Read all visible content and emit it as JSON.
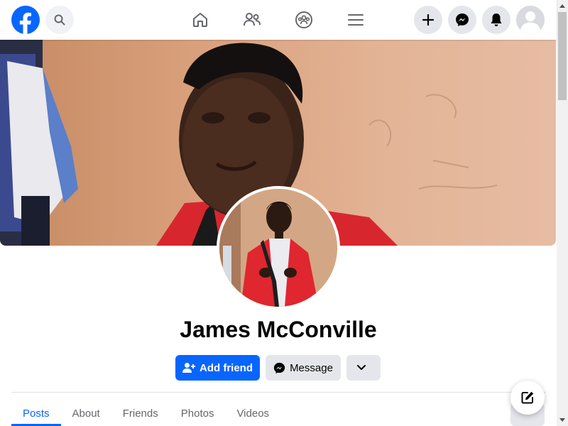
{
  "topbar": {
    "logo_icon": "facebook-logo-icon",
    "search_icon": "search-icon",
    "nav": [
      {
        "icon": "home-icon"
      },
      {
        "icon": "friends-icon"
      },
      {
        "icon": "groups-icon"
      },
      {
        "icon": "menu-icon"
      }
    ],
    "actions": [
      {
        "icon": "plus-icon"
      },
      {
        "icon": "messenger-icon"
      },
      {
        "icon": "bell-icon"
      }
    ],
    "accent": "#0866ff"
  },
  "profile": {
    "name": "James McConville",
    "add_friend_label": "Add friend",
    "message_label": "Message"
  },
  "tabs": [
    {
      "label": "Posts",
      "active": true
    },
    {
      "label": "About"
    },
    {
      "label": "Friends"
    },
    {
      "label": "Photos"
    },
    {
      "label": "Videos"
    }
  ],
  "compose_icon": "edit-icon"
}
